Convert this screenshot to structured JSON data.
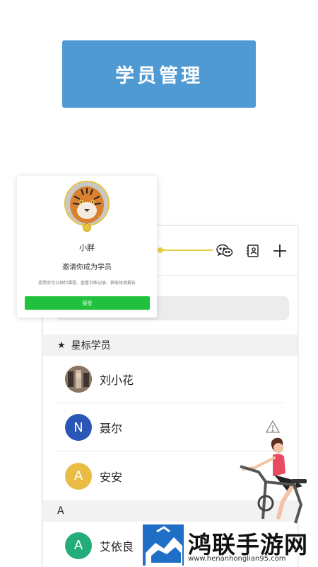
{
  "banner": {
    "title": "学员管理"
  },
  "invite_card": {
    "name": "小胖",
    "invite_text": "邀请你成为学员",
    "description": "接受后可以预约课程、查看训练记录、获取体测报告",
    "accept_label": "接受"
  },
  "search": {
    "placeholder": ""
  },
  "sections": {
    "starred": "星标学员",
    "group_a": "A"
  },
  "students": [
    {
      "name": "刘小花",
      "avatar_letter": "",
      "avatar_color": "#6b5a4a"
    },
    {
      "name": "聂尔",
      "avatar_letter": "N",
      "avatar_color": "#2a56b5"
    },
    {
      "name": "安安",
      "avatar_letter": "A",
      "avatar_color": "#e9bc45"
    },
    {
      "name": "艾依良",
      "avatar_letter": "A",
      "avatar_color": "#24ad7a"
    }
  ],
  "icons": {
    "wechat": "wechat-icon",
    "contact": "contact-card-icon",
    "add": "plus-icon",
    "warning": "warning-icon",
    "star": "star-icon"
  },
  "watermark": {
    "title": "鸿联手游网",
    "url": "www.henanhonglian95.com"
  }
}
